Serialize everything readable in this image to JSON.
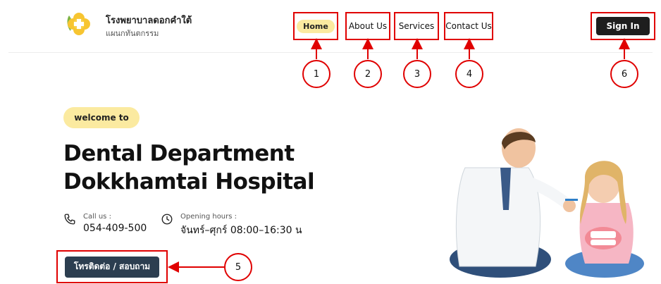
{
  "brand": {
    "title": "โรงพยาบาลดอกคำใต้",
    "subtitle": "แผนกทันตกรรม",
    "logo_icon": "flower-cross-logo"
  },
  "nav": {
    "items": [
      {
        "label": "Home",
        "active": true
      },
      {
        "label": "About Us"
      },
      {
        "label": "Services"
      },
      {
        "label": "Contact Us"
      }
    ],
    "signin_label": "Sign In"
  },
  "callouts": [
    "1",
    "2",
    "3",
    "4",
    "5",
    "6"
  ],
  "hero": {
    "welcome": "welcome to",
    "headline_line1": "Dental Department",
    "headline_line2": "Dokkhamtai Hospital",
    "call_label": "Call us :",
    "call_value": "054-409-500",
    "hours_label": "Opening hours :",
    "hours_value": "จันทร์–ศุกร์ 08:00–16:30 น",
    "cta_label": "โทรติดต่อ / สอบถาม",
    "image_subject": "dentist teaching child to brush teeth"
  },
  "colors": {
    "annotation_red": "#e00000",
    "pill_yellow": "#fbeaa0",
    "cta_navy": "#2c3e50",
    "signin_dark": "#1e1e1e"
  }
}
